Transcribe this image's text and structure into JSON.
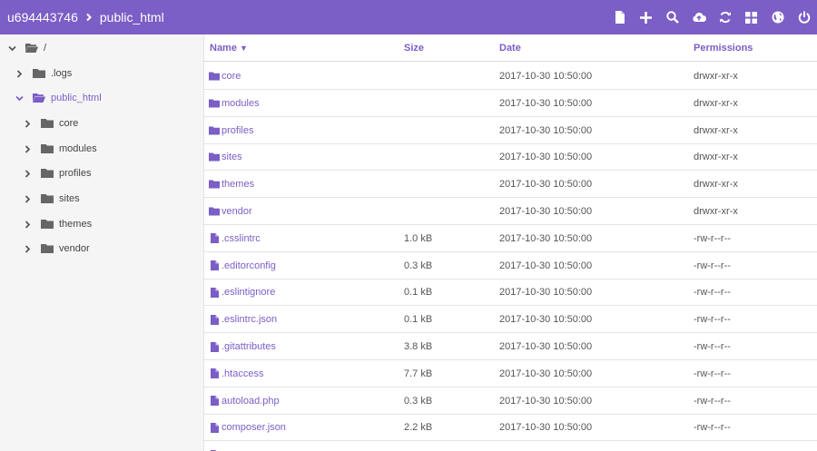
{
  "header": {
    "breadcrumbs": [
      "u694443746",
      "public_html"
    ],
    "accent_color": "#7b5ec6",
    "actions": [
      {
        "name": "new-file-icon",
        "label": "New file"
      },
      {
        "name": "plus-icon",
        "label": "New folder"
      },
      {
        "name": "search-icon",
        "label": "Search"
      },
      {
        "name": "upload-icon",
        "label": "Upload"
      },
      {
        "name": "refresh-icon",
        "label": "Refresh"
      },
      {
        "name": "grid-view-icon",
        "label": "View"
      },
      {
        "name": "globe-icon",
        "label": "Language"
      },
      {
        "name": "power-icon",
        "label": "Logout"
      }
    ]
  },
  "sidebar": {
    "root": {
      "label": "/"
    },
    "items": [
      {
        "label": ".logs"
      },
      {
        "label": "public_html"
      }
    ],
    "children": [
      {
        "label": "core"
      },
      {
        "label": "modules"
      },
      {
        "label": "profiles"
      },
      {
        "label": "sites"
      },
      {
        "label": "themes"
      },
      {
        "label": "vendor"
      }
    ]
  },
  "table": {
    "headers": {
      "name": "Name",
      "sort_indicator": "▼",
      "size": "Size",
      "date": "Date",
      "permissions": "Permissions"
    },
    "rows": [
      {
        "type": "folder",
        "name": "core",
        "size": "",
        "date": "2017-10-30 10:50:00",
        "permissions": "drwxr-xr-x"
      },
      {
        "type": "folder",
        "name": "modules",
        "size": "",
        "date": "2017-10-30 10:50:00",
        "permissions": "drwxr-xr-x"
      },
      {
        "type": "folder",
        "name": "profiles",
        "size": "",
        "date": "2017-10-30 10:50:00",
        "permissions": "drwxr-xr-x"
      },
      {
        "type": "folder",
        "name": "sites",
        "size": "",
        "date": "2017-10-30 10:50:00",
        "permissions": "drwxr-xr-x"
      },
      {
        "type": "folder",
        "name": "themes",
        "size": "",
        "date": "2017-10-30 10:50:00",
        "permissions": "drwxr-xr-x"
      },
      {
        "type": "folder",
        "name": "vendor",
        "size": "",
        "date": "2017-10-30 10:50:00",
        "permissions": "drwxr-xr-x"
      },
      {
        "type": "file",
        "name": ".csslintrc",
        "size": "1.0 kB",
        "date": "2017-10-30 10:50:00",
        "permissions": "-rw-r--r--"
      },
      {
        "type": "file",
        "name": ".editorconfig",
        "size": "0.3 kB",
        "date": "2017-10-30 10:50:00",
        "permissions": "-rw-r--r--"
      },
      {
        "type": "file",
        "name": ".eslintignore",
        "size": "0.1 kB",
        "date": "2017-10-30 10:50:00",
        "permissions": "-rw-r--r--"
      },
      {
        "type": "file",
        "name": ".eslintrc.json",
        "size": "0.1 kB",
        "date": "2017-10-30 10:50:00",
        "permissions": "-rw-r--r--"
      },
      {
        "type": "file",
        "name": ".gitattributes",
        "size": "3.8 kB",
        "date": "2017-10-30 10:50:00",
        "permissions": "-rw-r--r--"
      },
      {
        "type": "file",
        "name": ".htaccess",
        "size": "7.7 kB",
        "date": "2017-10-30 10:50:00",
        "permissions": "-rw-r--r--"
      },
      {
        "type": "file",
        "name": "autoload.php",
        "size": "0.3 kB",
        "date": "2017-10-30 10:50:00",
        "permissions": "-rw-r--r--"
      },
      {
        "type": "file",
        "name": "composer.json",
        "size": "2.2 kB",
        "date": "2017-10-30 10:50:00",
        "permissions": "-rw-r--r--"
      },
      {
        "type": "file",
        "name": "",
        "size": "",
        "date": "",
        "permissions": ""
      }
    ]
  }
}
